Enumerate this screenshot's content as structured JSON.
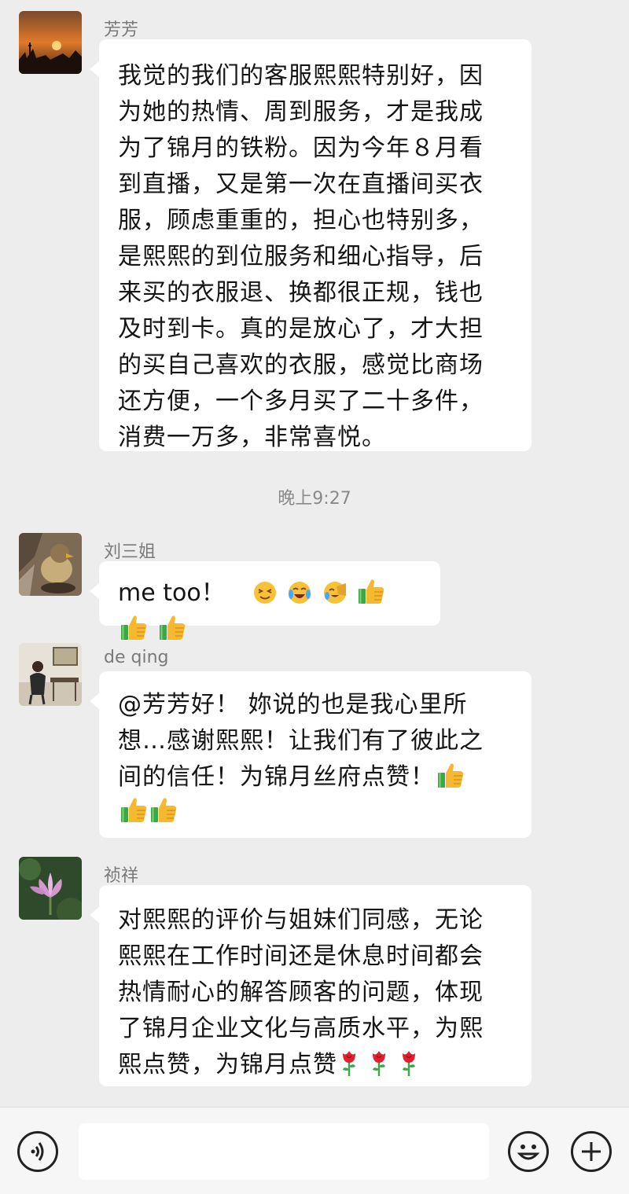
{
  "messages": [
    {
      "sender": "芳芳",
      "lines": [
        "我觉的我们的客服熙熙特别好，因",
        "为她的热情、周到服务，才是我成",
        "为了锦月的铁粉。因为今年８月看",
        "到直播，又是第一次在直播间买衣",
        "服，顾虑重重的，担心也特别多，",
        "是熙熙的到位服务和细心指导，后",
        "来买的衣服退、换都很正规，钱也",
        "及时到卡。真的是放心了，才大担",
        "的买自己喜欢的衣服，感觉比商场",
        "还方便，一个多月买了二十多件，",
        "消费一万多，非常喜悦。"
      ]
    },
    {
      "sender": "刘三姐",
      "text": "me too！"
    },
    {
      "sender": "de qing",
      "lines": [
        "@芳芳好！  妳说的也是我心里所",
        "想…感谢熙熙！让我们有了彼此之",
        "间的信任！为锦月丝府点赞！"
      ]
    },
    {
      "sender": "祯祥",
      "lines": [
        "对熙熙的评价与姐妹们同感，无论",
        "熙熙在工作时间还是休息时间都会",
        "热情耐心的解答顾客的问题，体现",
        "了锦月企业文化与高质水平，为熙",
        "熙点赞，为锦月点赞"
      ]
    }
  ],
  "timestamp": "晚上9:27",
  "emoji": {
    "me_too": [
      "squint-smile-emoji",
      "tears-of-joy-emoji",
      "laughing-cover-face-emoji",
      "thumbs-up-emoji",
      "thumbs-up-emoji",
      "thumbs-up-emoji"
    ],
    "de_qing": [
      "thumbs-up-emoji",
      "thumbs-up-emoji",
      "thumbs-up-emoji"
    ],
    "zhenxiang": [
      "rose-emoji",
      "rose-emoji",
      "rose-emoji"
    ]
  },
  "bottom_bar": {
    "voice_icon": "voice-icon",
    "emoji_icon": "emoji-icon",
    "plus_icon": "plus-icon"
  },
  "colors": {
    "background": "#ededed",
    "bubble": "#ffffff",
    "thumb_yellow": "#f5b82e",
    "sleeve_green": "#3aa845",
    "rose_red": "#e0202f"
  }
}
